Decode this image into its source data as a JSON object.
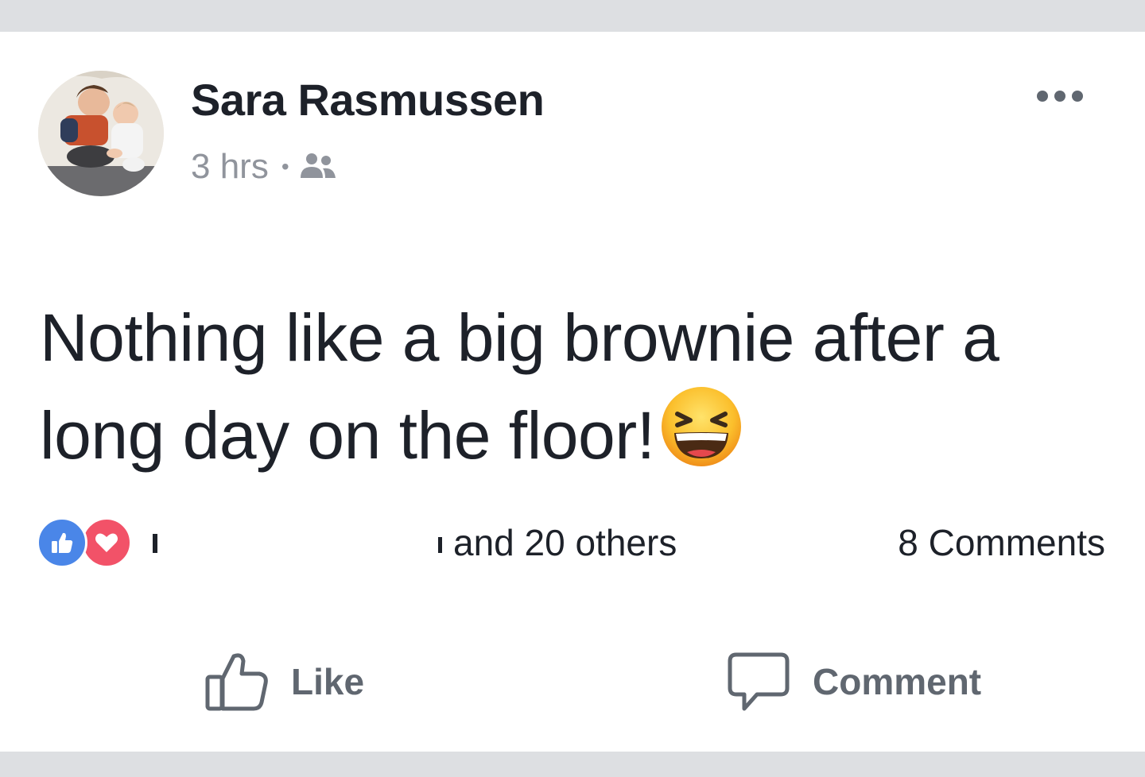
{
  "post": {
    "author": "Sara Rasmussen",
    "time": "3 hrs",
    "separator": "•",
    "audience_icon": "friends-icon",
    "text": "Nothing like a big brownie after a long day on the floor!",
    "emoji": "grinning-squinting-face-emoji",
    "more_icon": "more-options-icon"
  },
  "reactions": {
    "icons": [
      "like-reaction-icon",
      "love-reaction-icon"
    ],
    "visible_name_start": "S",
    "redacted": true,
    "suffix": "and 20 others",
    "comments": "8 Comments"
  },
  "actions": {
    "like_label": "Like",
    "comment_label": "Comment"
  },
  "colors": {
    "page_background": "#dddfe2",
    "card_background": "#ffffff",
    "text_primary": "#1d2129",
    "text_secondary": "#90949c",
    "action_text": "#606770",
    "like_blue": "#4a86e8",
    "love_red": "#f25268"
  }
}
